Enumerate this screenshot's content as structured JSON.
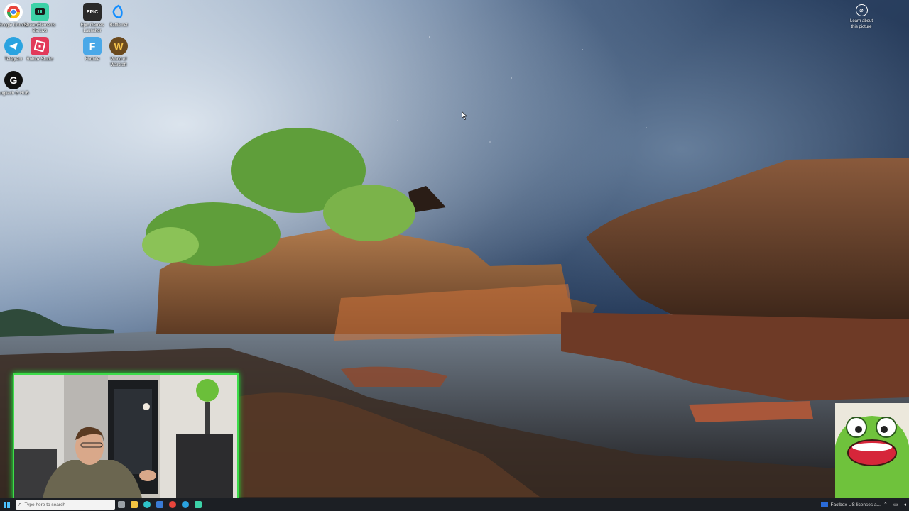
{
  "desktop": {
    "icons": [
      {
        "label": "Google Chrome",
        "icon": "chrome-icon",
        "color": "#e8453c"
      },
      {
        "label": "StreamElements SE.Live",
        "icon": "streamelements-icon",
        "color": "#3cd1a7"
      },
      {
        "label": "Epic Games Launcher",
        "icon": "epic-games-icon",
        "color": "#2a2a2a"
      },
      {
        "label": "Battle.net",
        "icon": "battlenet-icon",
        "color": "#148eff"
      },
      {
        "label": "Telegram",
        "icon": "telegram-icon",
        "color": "#2aa3e0"
      },
      {
        "label": "Roblox Studio",
        "icon": "roblox-studio-icon",
        "color": "#e23a5a"
      },
      {
        "label": "Fortnite",
        "icon": "fortnite-icon",
        "color": "#4aa8e8"
      },
      {
        "label": "World of Warcraft",
        "icon": "wow-icon",
        "color": "#6b4a1e"
      },
      {
        "label": "Logitech G HUB",
        "icon": "logitech-ghub-icon",
        "color": "#111111"
      }
    ],
    "learn_picture": {
      "label": "Learn about this picture",
      "icon": "camera-icon"
    }
  },
  "taskbar": {
    "search_placeholder": "Type here to search",
    "notification_text": "Factbox-US licenses a...",
    "apps": [
      {
        "icon": "task-view-icon",
        "color": "#9aa0a6"
      },
      {
        "icon": "file-explorer-icon",
        "color": "#f4c542"
      },
      {
        "icon": "edge-icon",
        "color": "#2ec3c9"
      },
      {
        "icon": "store-icon",
        "color": "#3a7bd5"
      },
      {
        "icon": "chrome-icon",
        "color": "#e8453c"
      },
      {
        "icon": "telegram-icon",
        "color": "#2aa3e0"
      },
      {
        "icon": "streamelements-icon",
        "color": "#3cd1a7"
      }
    ]
  },
  "colors": {
    "webcam_border": "#3ddc4a",
    "taskbar_bg": "#1c1f24",
    "accent": "#4cc2ff"
  }
}
